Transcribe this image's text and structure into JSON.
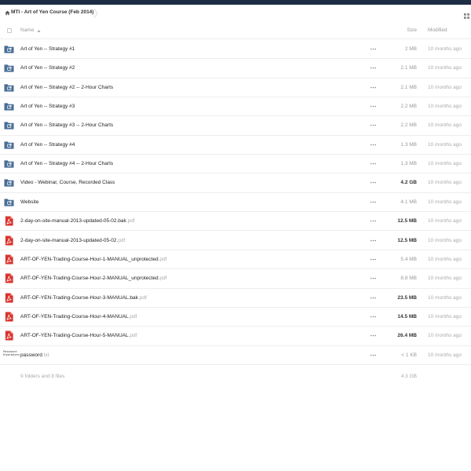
{
  "breadcrumb": {
    "home_icon": "home-icon",
    "current": "MTI - Art of Yen Course (Feb 2014)"
  },
  "view_toggle_icon": "grid-view-icon",
  "table_header": {
    "name": "Name",
    "size": "Size",
    "modified": "Modified"
  },
  "colors": {
    "topbar": "#1d2d44",
    "folder": "#4a6f97",
    "pdf": "#d9332c"
  },
  "files": [
    {
      "type": "folder",
      "icon": "shared-folder-icon",
      "name": "Art of Yen -- Strategy #1",
      "ext": "",
      "size": "2 MB",
      "size_strong": false,
      "modified": "10 months ago"
    },
    {
      "type": "folder",
      "icon": "shared-folder-icon",
      "name": "Art of Yen -- Strategy #2",
      "ext": "",
      "size": "2.1 MB",
      "size_strong": false,
      "modified": "10 months ago"
    },
    {
      "type": "folder",
      "icon": "shared-folder-icon",
      "name": "Art of Yen -- Strategy #2 -- 2-Hour Charts",
      "ext": "",
      "size": "2.1 MB",
      "size_strong": false,
      "modified": "10 months ago"
    },
    {
      "type": "folder",
      "icon": "shared-folder-icon",
      "name": "Art of Yen -- Strategy #3",
      "ext": "",
      "size": "2.2 MB",
      "size_strong": false,
      "modified": "10 months ago"
    },
    {
      "type": "folder",
      "icon": "shared-folder-icon",
      "name": "Art of Yen -- Strategy #3 -- 2-Hour Charts",
      "ext": "",
      "size": "2.2 MB",
      "size_strong": false,
      "modified": "10 months ago"
    },
    {
      "type": "folder",
      "icon": "shared-folder-icon",
      "name": "Art of Yen -- Strategy #4",
      "ext": "",
      "size": "1.3 MB",
      "size_strong": false,
      "modified": "10 months ago"
    },
    {
      "type": "folder",
      "icon": "shared-folder-icon",
      "name": "Art of Yen -- Strategy #4 -- 2-Hour Charts",
      "ext": "",
      "size": "1.3 MB",
      "size_strong": false,
      "modified": "10 months ago"
    },
    {
      "type": "folder",
      "icon": "shared-folder-icon",
      "name": "Video - Webinar, Course, Recorded Class",
      "ext": "",
      "size": "4.2 GB",
      "size_strong": true,
      "modified": "10 months ago"
    },
    {
      "type": "folder",
      "icon": "shared-folder-icon",
      "name": "Website",
      "ext": "",
      "size": "4.1 MB",
      "size_strong": false,
      "modified": "10 months ago"
    },
    {
      "type": "pdf",
      "icon": "pdf-icon",
      "name": "2-day-on-site-manual-2013-updated-05-02.bak",
      "ext": ".pdf",
      "size": "12.5 MB",
      "size_strong": true,
      "modified": "10 months ago"
    },
    {
      "type": "pdf",
      "icon": "pdf-icon",
      "name": "2-day-on-site-manual-2013-updated-05-02",
      "ext": ".pdf",
      "size": "12.5 MB",
      "size_strong": true,
      "modified": "10 months ago"
    },
    {
      "type": "pdf",
      "icon": "pdf-icon",
      "name": "ART-OF-YEN-Trading-Course-Hour-1-MANUAL_unprotected",
      "ext": ".pdf",
      "size": "5.4 MB",
      "size_strong": false,
      "modified": "10 months ago"
    },
    {
      "type": "pdf",
      "icon": "pdf-icon",
      "name": "ART-OF-YEN-Trading-Course-Hour-2-MANUAL_unprotected",
      "ext": ".pdf",
      "size": "8.8 MB",
      "size_strong": false,
      "modified": "10 months ago"
    },
    {
      "type": "pdf",
      "icon": "pdf-icon",
      "name": "ART-OF-YEN-Trading-Course-Hour-3-MANUAL.bak",
      "ext": ".pdf",
      "size": "23.5 MB",
      "size_strong": true,
      "modified": "10 months ago"
    },
    {
      "type": "pdf",
      "icon": "pdf-icon",
      "name": "ART-OF-YEN-Trading-Course-Hour-4-MANUAL",
      "ext": ".pdf",
      "size": "14.5 MB",
      "size_strong": true,
      "modified": "10 months ago"
    },
    {
      "type": "pdf",
      "icon": "pdf-icon",
      "name": "ART-OF-YEN-Trading-Course-Hour-5-MANUAL",
      "ext": ".pdf",
      "size": "26.4 MB",
      "size_strong": true,
      "modified": "10 months ago"
    },
    {
      "type": "text",
      "icon": "text-file-preview-icon",
      "preview": [
        "Password:",
        "theartofyen"
      ],
      "name": "password",
      "ext": ".txt",
      "size": "< 1 KB",
      "size_strong": false,
      "modified": "10 months ago"
    }
  ],
  "menu_icon": "more-options-icon",
  "summary": {
    "count": "9 folders and 8 files",
    "total_size": "4.3 GB"
  }
}
